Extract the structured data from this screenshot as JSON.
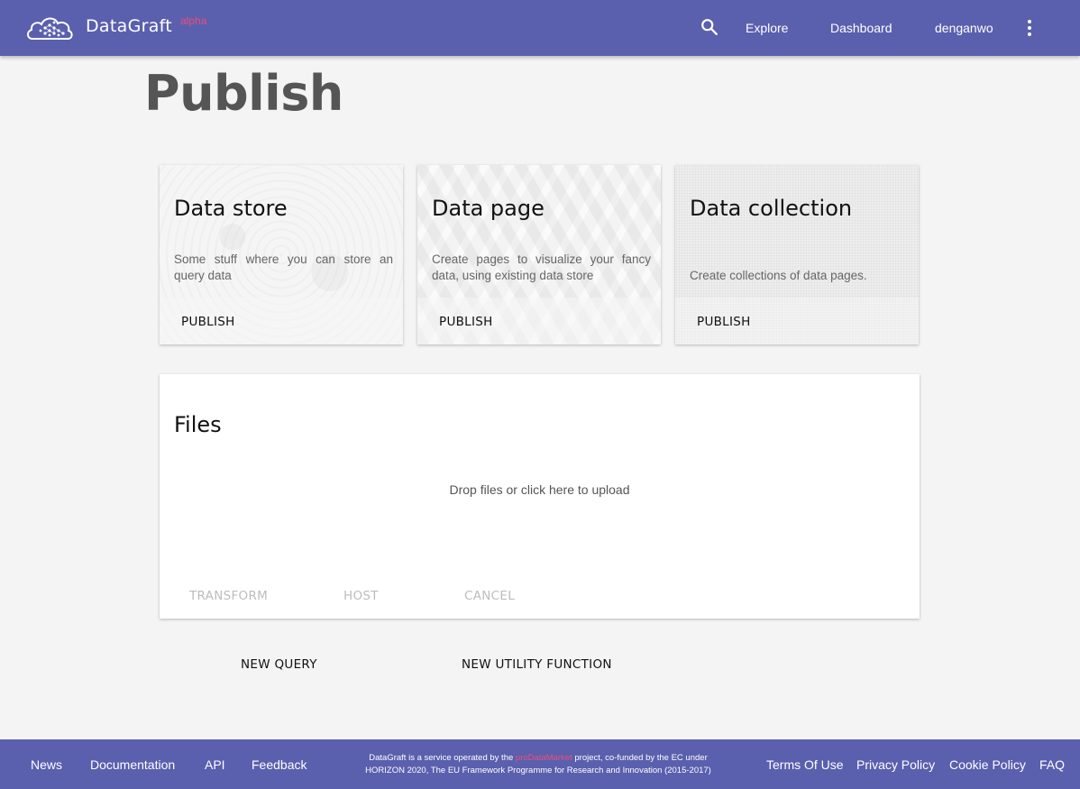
{
  "header": {
    "brand": "DataGraft",
    "brand_sup": "alpha",
    "nav": {
      "explore": "Explore",
      "dashboard": "Dashboard",
      "user": "denganwo"
    },
    "icons": {
      "logo": "cloud-logo-icon",
      "search": "search-icon",
      "more": "more-vert-icon"
    }
  },
  "page": {
    "title": "Publish"
  },
  "cards": [
    {
      "title": "Data store",
      "description": "Some stuff where you can store an query data",
      "action": "PUBLISH"
    },
    {
      "title": "Data page",
      "description": "Create pages to visualize your fancy data, using existing data store",
      "action": "PUBLISH"
    },
    {
      "title": "Data collection",
      "description": "Create collections of data pages.",
      "action": "PUBLISH"
    }
  ],
  "files": {
    "title": "Files",
    "dropzone": "Drop files or click here to upload",
    "actions": {
      "transform": "TRANSFORM",
      "host": "HOST",
      "cancel": "CANCEL"
    }
  },
  "bottom_actions": {
    "new_query": "NEW QUERY",
    "new_utility": "NEW UTILITY FUNCTION"
  },
  "footer": {
    "links_left": {
      "news": "News",
      "documentation": "Documentation",
      "api": "API",
      "feedback": "Feedback"
    },
    "notice": {
      "pre": "DataGraft is a service operated by the ",
      "project": "proDataMarket",
      "post": " project, co-funded by the EC under HORIZON 2020, The EU Framework Programme for Research and Innovation (2015-2017)"
    },
    "links_right": {
      "terms": "Terms Of Use",
      "privacy": "Privacy Policy",
      "cookie": "Cookie Policy",
      "faq": "FAQ"
    }
  },
  "colors": {
    "primary": "#5a5fae",
    "accent": "#e8507a",
    "background": "#f4f4f4"
  }
}
